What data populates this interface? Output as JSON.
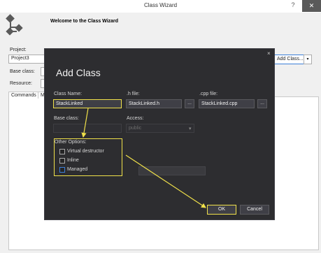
{
  "window": {
    "title": "Class Wizard",
    "help": "?",
    "close": "✕",
    "welcome": "Welcome to the Class Wizard"
  },
  "wizard": {
    "project_label": "Project:",
    "project_value": "Project3",
    "base_class_label": "Base class:",
    "resource_label": "Resource:",
    "add_class_label": "Add Class...",
    "add_class_arrow": "▾",
    "tabs": [
      {
        "label": "Commands"
      },
      {
        "label": "M"
      }
    ]
  },
  "dialog": {
    "title": "Add Class",
    "close": "×",
    "class_name_label": "Class Name:",
    "class_name_value": "StackLinked",
    "h_file_label": ".h file:",
    "h_file_value": "StackLinked.h",
    "cpp_file_label": ".cpp file:",
    "cpp_file_value": "StackLinked.cpp",
    "browse_label": "...",
    "base_class_label": "Base class:",
    "access_label": "Access:",
    "access_value": "public",
    "access_arrow": "▾",
    "other_options_label": "Other Options:",
    "options": [
      {
        "label": "Virtual destructor"
      },
      {
        "label": "Inline"
      },
      {
        "label": "Managed"
      }
    ],
    "ok_label": "OK",
    "cancel_label": "Cancel"
  },
  "colors": {
    "highlight": "#f0e14a",
    "dialog_bg": "#2d2d30"
  }
}
